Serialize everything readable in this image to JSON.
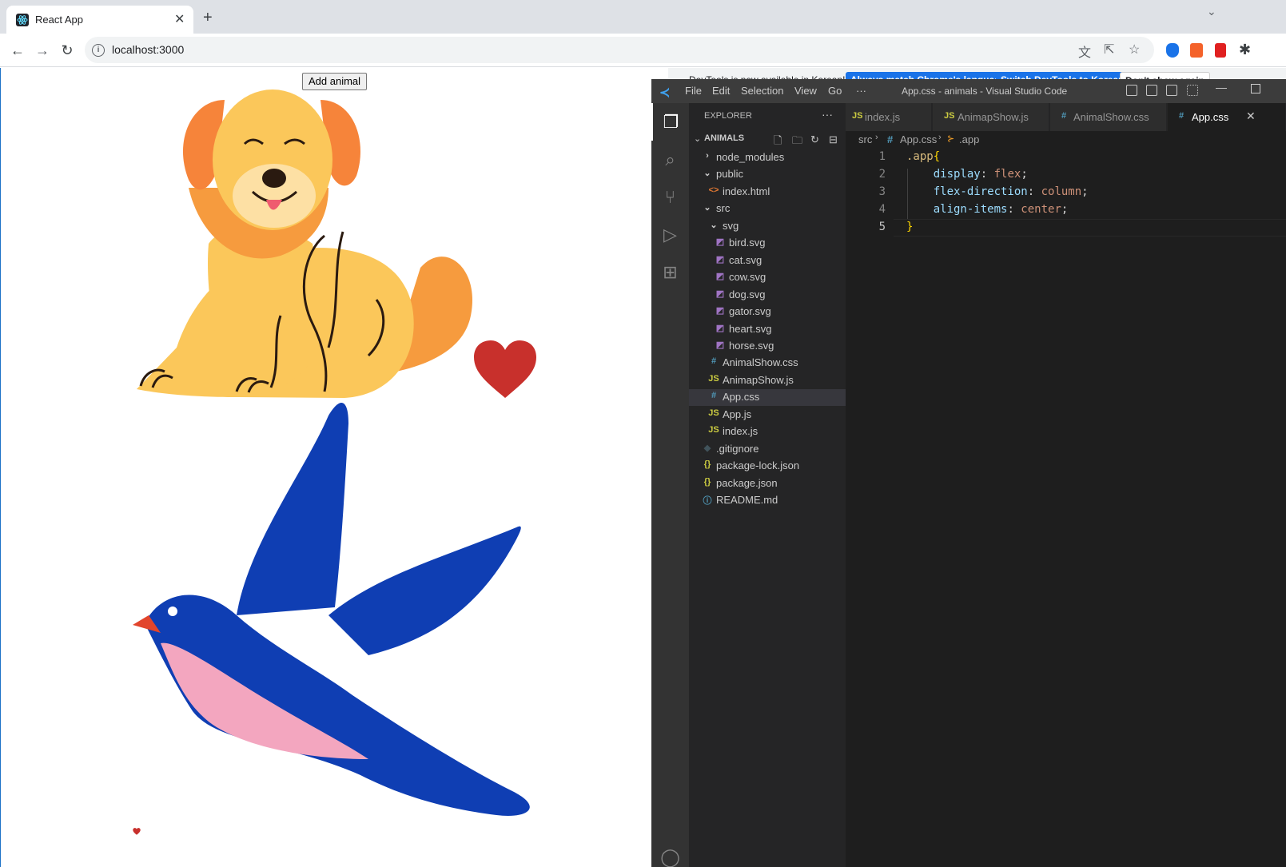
{
  "browser": {
    "tab_title": "React App",
    "url": "localhost:3000"
  },
  "page": {
    "add_button": "Add animal"
  },
  "devtools_banner": {
    "text": "DevTools is now available in Korean!",
    "btn_match": "Always match Chrome's language",
    "btn_switch": "Switch DevTools to Korean",
    "btn_dont": "Don't show again"
  },
  "vscode": {
    "menus": [
      "File",
      "Edit",
      "Selection",
      "View",
      "Go",
      "···"
    ],
    "title": "App.css - animals - Visual Studio Code",
    "explorer_title": "EXPLORER",
    "explorer_more": "···",
    "folder": "ANIMALS",
    "tree": [
      {
        "label": "node_modules",
        "icon": "›",
        "kind": "folder"
      },
      {
        "label": "public",
        "icon": "⌄",
        "kind": "folder"
      },
      {
        "label": "index.html",
        "icon": "<>",
        "kind": "html"
      },
      {
        "label": "src",
        "icon": "⌄",
        "kind": "folder"
      },
      {
        "label": "svg",
        "icon": "⌄",
        "kind": "folder"
      },
      {
        "label": "bird.svg",
        "icon": "◩",
        "kind": "svg"
      },
      {
        "label": "cat.svg",
        "icon": "◩",
        "kind": "svg"
      },
      {
        "label": "cow.svg",
        "icon": "◩",
        "kind": "svg"
      },
      {
        "label": "dog.svg",
        "icon": "◩",
        "kind": "svg"
      },
      {
        "label": "gator.svg",
        "icon": "◩",
        "kind": "svg"
      },
      {
        "label": "heart.svg",
        "icon": "◩",
        "kind": "svg"
      },
      {
        "label": "horse.svg",
        "icon": "◩",
        "kind": "svg"
      },
      {
        "label": "AnimalShow.css",
        "icon": "#",
        "kind": "css"
      },
      {
        "label": "AnimapShow.js",
        "icon": "JS",
        "kind": "js"
      },
      {
        "label": "App.css",
        "icon": "#",
        "kind": "css"
      },
      {
        "label": "App.js",
        "icon": "JS",
        "kind": "js"
      },
      {
        "label": "index.js",
        "icon": "JS",
        "kind": "js"
      },
      {
        "label": ".gitignore",
        "icon": "◆",
        "kind": "git"
      },
      {
        "label": "package-lock.json",
        "icon": "{}",
        "kind": "json"
      },
      {
        "label": "package.json",
        "icon": "{}",
        "kind": "json"
      },
      {
        "label": "README.md",
        "icon": "ⓘ",
        "kind": "md"
      }
    ],
    "editor_tabs": [
      {
        "label": "index.js",
        "icon": "JS"
      },
      {
        "label": "AnimapShow.js",
        "icon": "JS"
      },
      {
        "label": "AnimalShow.css",
        "icon": "#"
      },
      {
        "label": "App.css",
        "icon": "#"
      }
    ],
    "breadcrumbs": {
      "a": "src",
      "b": "App.css",
      "c": ".app"
    },
    "code": [
      {
        "n": "1",
        "sel": ".app",
        "brace": "{"
      },
      {
        "n": "2",
        "prop": "display",
        "val": "flex"
      },
      {
        "n": "3",
        "prop": "flex-direction",
        "val": "column"
      },
      {
        "n": "4",
        "prop": "align-items",
        "val": "center"
      },
      {
        "n": "5",
        "brace": "}"
      }
    ]
  },
  "colors": {
    "dog_body": "#fbc75a",
    "dog_ears": "#f6843a",
    "heart": "#c8302c",
    "bird_blue": "#0f3eb3",
    "bird_belly": "#f3a6bf",
    "beak": "#e2452c"
  }
}
